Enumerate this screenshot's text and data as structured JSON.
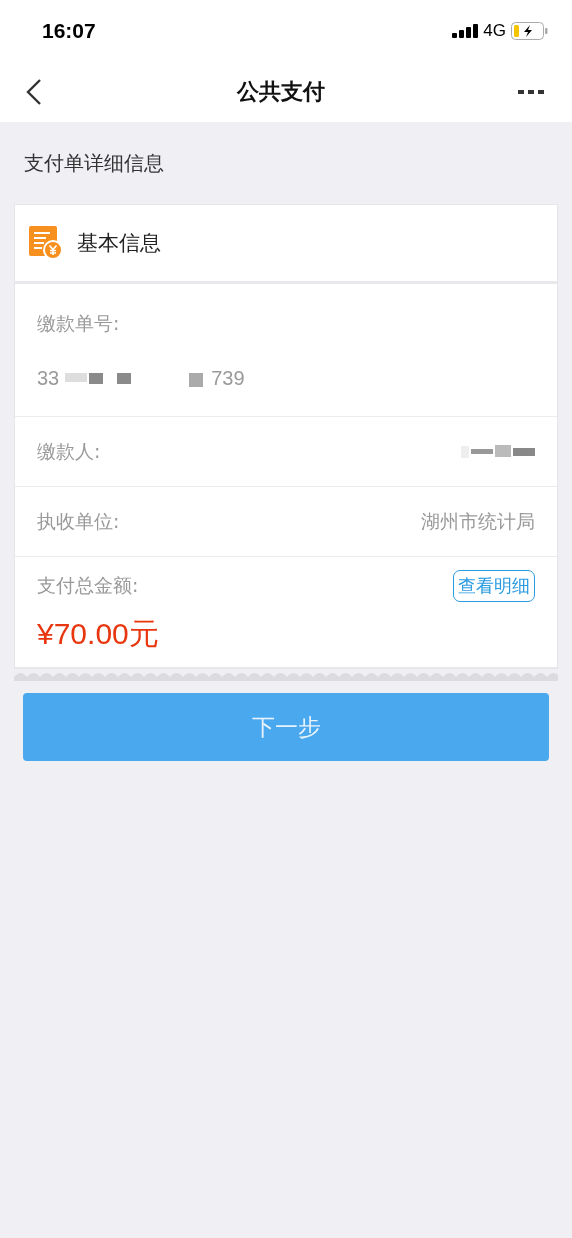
{
  "status_bar": {
    "time": "16:07",
    "network": "4G"
  },
  "nav_bar": {
    "title": "公共支付"
  },
  "section_title": "支付单详细信息",
  "card": {
    "title": "基本信息",
    "rows": [
      {
        "kind": "stacked",
        "label": "缴款单号:",
        "value_parts": [
          "33",
          "739"
        ]
      },
      {
        "kind": "redacted",
        "label": "缴款人:"
      },
      {
        "kind": "inline",
        "label": "执收单位:",
        "value": "湖州市统计局"
      },
      {
        "kind": "amount",
        "label": "支付总金额:",
        "action": "查看明细",
        "value": "¥70.00元"
      }
    ]
  },
  "next_button": "下一步"
}
